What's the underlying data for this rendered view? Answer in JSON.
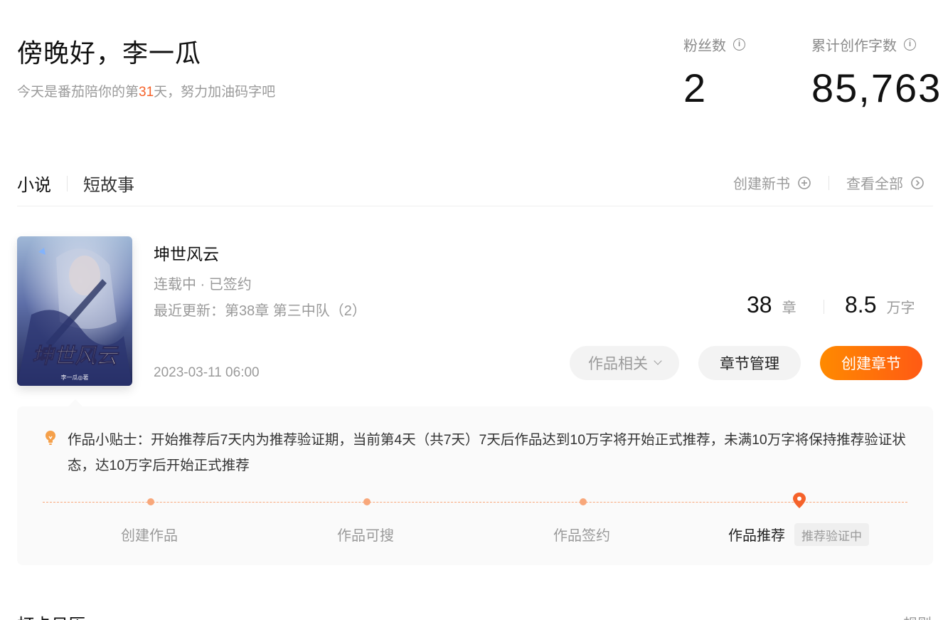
{
  "header": {
    "greeting": "傍晚好，李一瓜",
    "subtitle_prefix": "今天是番茄陪你的第",
    "subtitle_days": "31",
    "subtitle_suffix": "天，努力加油码字吧"
  },
  "stats": {
    "fans_label": "粉丝数",
    "fans_value": "2",
    "words_label": "累计创作字数",
    "words_value": "85,763"
  },
  "tabs": [
    {
      "label": "小说",
      "active": true
    },
    {
      "label": "短故事",
      "active": false
    }
  ],
  "actions": {
    "create_book": "创建新书",
    "view_all": "查看全部"
  },
  "book": {
    "title": "坤世风云",
    "status": "连载中 · 已签约",
    "last_update": "最近更新：第38章 第三中队（2）",
    "date": "2023-03-11 06:00",
    "chapters_num": "38",
    "chapters_unit": "章",
    "words_num": "8.5",
    "words_unit": "万字",
    "cover_title": "坤世风云",
    "cover_author": "李一瓜◎著"
  },
  "buttons": {
    "related": "作品相关",
    "chapters": "章节管理",
    "create_chapter": "创建章节"
  },
  "tip": {
    "text": "作品小贴士：开始推荐后7天内为推荐验证期，当前第4天（共7天）7天后作品达到10万字将开始正式推荐，未满10万字将保持推荐验证状态，达10万字后开始正式推荐"
  },
  "timeline": {
    "steps": [
      "创建作品",
      "作品可搜",
      "作品签约",
      "作品推荐"
    ],
    "current_badge": "推荐验证中"
  },
  "bottom": {
    "section_title": "打卡日历",
    "right_link": "规则"
  },
  "colors": {
    "accent": "#f5622a",
    "button_gradient_start": "#ff8a00",
    "button_gradient_end": "#ff5a14",
    "timeline": "#f8a77a"
  }
}
